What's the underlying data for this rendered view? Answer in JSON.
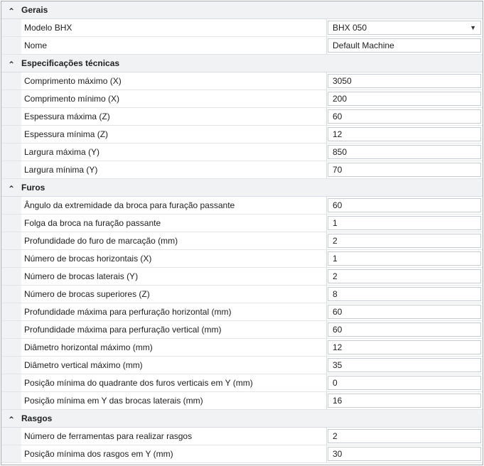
{
  "groups": [
    {
      "title": "Gerais",
      "rows": [
        {
          "label": "Modelo BHX",
          "value": "BHX 050",
          "combo": true
        },
        {
          "label": "Nome",
          "value": "Default Machine"
        }
      ]
    },
    {
      "title": "Especificações técnicas",
      "rows": [
        {
          "label": "Comprimento máximo (X)",
          "value": "3050"
        },
        {
          "label": "Comprimento mínimo (X)",
          "value": "200"
        },
        {
          "label": "Espessura máxima (Z)",
          "value": "60"
        },
        {
          "label": "Espessura mínima (Z)",
          "value": "12"
        },
        {
          "label": "Largura máxima (Y)",
          "value": "850"
        },
        {
          "label": "Largura mínima (Y)",
          "value": "70"
        }
      ]
    },
    {
      "title": "Furos",
      "rows": [
        {
          "label": "Ângulo da extremidade da broca para furação passante",
          "value": "60"
        },
        {
          "label": "Folga da broca na furação passante",
          "value": "1"
        },
        {
          "label": "Profundidade do furo de marcação (mm)",
          "value": "2"
        },
        {
          "label": "Número de brocas horizontais (X)",
          "value": "1"
        },
        {
          "label": "Número de brocas laterais (Y)",
          "value": "2"
        },
        {
          "label": "Número de brocas superiores (Z)",
          "value": "8"
        },
        {
          "label": "Profundidade máxima para perfuração horizontal (mm)",
          "value": "60"
        },
        {
          "label": "Profundidade máxima para perfuração vertical (mm)",
          "value": "60"
        },
        {
          "label": "Diâmetro horizontal máximo (mm)",
          "value": "12"
        },
        {
          "label": "Diâmetro vertical máximo (mm)",
          "value": "35"
        },
        {
          "label": "Posição mínima do quadrante dos furos verticais em Y (mm)",
          "value": "0"
        },
        {
          "label": "Posição mínima em Y das brocas laterais (mm)",
          "value": "16"
        }
      ]
    },
    {
      "title": "Rasgos",
      "rows": [
        {
          "label": "Número de ferramentas para realizar rasgos",
          "value": "2"
        },
        {
          "label": "Posição mínima dos rasgos em Y (mm)",
          "value": "30"
        }
      ]
    }
  ],
  "icons": {
    "collapse": "chevron-up-icon",
    "dropdown": "caret-down-icon"
  }
}
